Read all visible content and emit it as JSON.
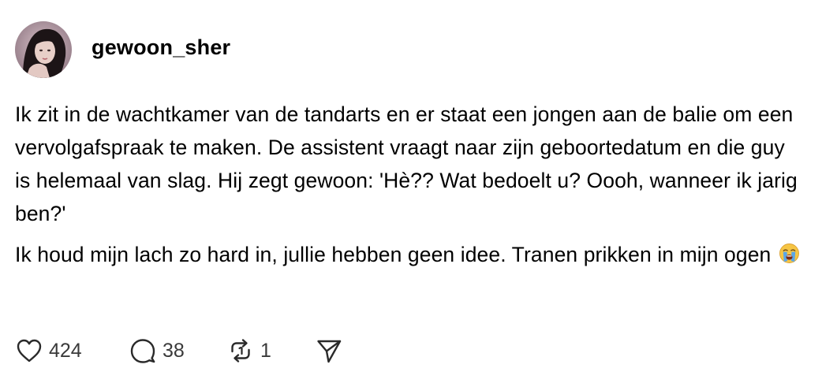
{
  "post": {
    "username": "gewoon_sher",
    "paragraphs": [
      "Ik zit in de wachtkamer van de tandarts en er staat een jongen aan de balie om een vervolgafspraak te maken. De assistent vraagt naar zijn geboortedatum en die guy is helemaal van slag. Hij zegt gewoon: 'Hè?? Wat bedoelt u? Oooh, wanneer ik jarig ben?'",
      "Ik houd mijn lach zo hard in, jullie hebben geen idee. Tranen prikken in mijn ogen"
    ],
    "emoji": "loudly-crying-face"
  },
  "actions": {
    "like_count": "424",
    "comment_count": "38",
    "repost_count": "1",
    "like_icon": "heart-icon",
    "comment_icon": "comment-bubble-icon",
    "repost_icon": "repost-icon",
    "share_icon": "send-icon"
  },
  "colors": {
    "text": "#000000",
    "icon": "#2a2a2a",
    "count": "#3a3a3a",
    "background": "#ffffff"
  }
}
